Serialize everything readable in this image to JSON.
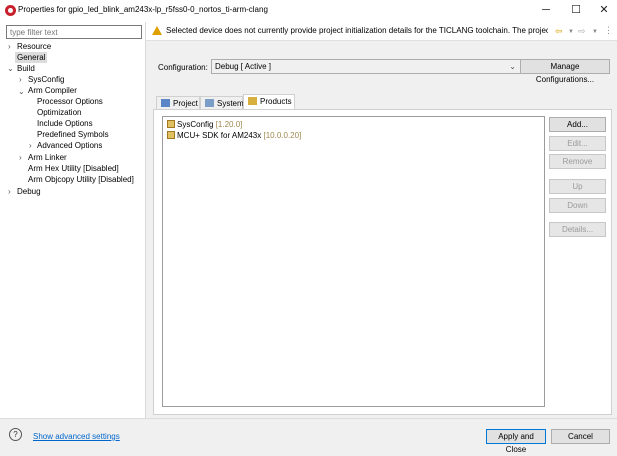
{
  "window": {
    "title": "Properties for gpio_led_blink_am243x-lp_r5fss0-0_nortos_ti-arm-clang",
    "minimize_glyph": "─",
    "maximize_glyph": "☐",
    "close_glyph": "✕"
  },
  "filter": {
    "placeholder": "type filter text"
  },
  "tree": {
    "resource": "Resource",
    "general": "General",
    "build": "Build",
    "sysconfig": "SysConfig",
    "arm_compiler": "Arm Compiler",
    "processor_options": "Processor Options",
    "optimization": "Optimization",
    "include_options": "Include Options",
    "predefined_symbols": "Predefined Symbols",
    "advanced_options": "Advanced Options",
    "arm_linker": "Arm Linker",
    "arm_hex_utility": "Arm Hex Utility  [Disabled]",
    "arm_objcopy_utility": "Arm Objcopy Utility  [Disabled]",
    "debug": "Debug"
  },
  "warning": {
    "text": "Selected device does not currently provide project initialization details for the TICLANG toolchain. The project may re"
  },
  "configuration": {
    "label": "Configuration:",
    "value": "Debug  [ Active ]",
    "manage_button": "Manage Configurations..."
  },
  "tabs": {
    "project": "Project",
    "system": "System",
    "products": "Products"
  },
  "products": [
    {
      "name": "SysConfig",
      "version": "[1.20.0]"
    },
    {
      "name": "MCU+ SDK for AM243x",
      "version": "[10.0.0.20]"
    }
  ],
  "product_buttons": {
    "add": "Add...",
    "edit": "Edit...",
    "remove": "Remove",
    "up": "Up",
    "down": "Down",
    "details": "Details..."
  },
  "bottom": {
    "help_glyph": "?",
    "show_advanced": "Show advanced settings",
    "apply_close": "Apply and Close",
    "cancel": "Cancel"
  },
  "icons": {
    "app": "ti-logo-icon",
    "warning": "warning-icon",
    "back": "back-arrow-icon",
    "forward": "forward-arrow-icon",
    "menu": "view-menu-icon"
  }
}
